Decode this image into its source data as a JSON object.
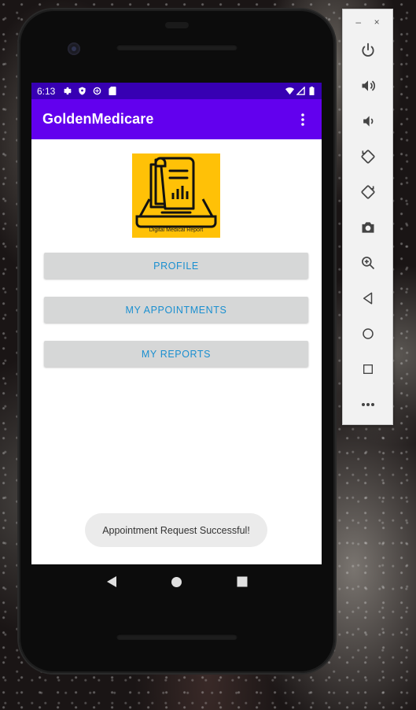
{
  "status_bar": {
    "time": "6:13"
  },
  "app_bar": {
    "title": "GoldenMedicare",
    "overflow_icon": "more-vert-icon"
  },
  "logo": {
    "caption": "Digital Medical Report",
    "background_color": "#ffc107"
  },
  "buttons": {
    "profile": "PROFILE",
    "appointments": "MY APPOINTMENTS",
    "reports": "MY REPORTS"
  },
  "toast": {
    "message": "Appointment Request Successful!"
  },
  "nav_bar": {
    "icons": [
      "back-icon",
      "home-icon",
      "recents-icon"
    ]
  },
  "emulator_toolbar": {
    "minimize": "–",
    "close": "×",
    "tools": [
      "power-icon",
      "volume-up-icon",
      "volume-down-icon",
      "rotate-left-icon",
      "rotate-right-icon",
      "screenshot-icon",
      "zoom-icon",
      "back-icon",
      "home-icon",
      "overview-icon",
      "more-icon"
    ]
  },
  "colors": {
    "status_bar": "#3700b3",
    "app_bar": "#6200ee",
    "button_bg": "#d6d7d7",
    "button_text": "#1a8fd0"
  }
}
